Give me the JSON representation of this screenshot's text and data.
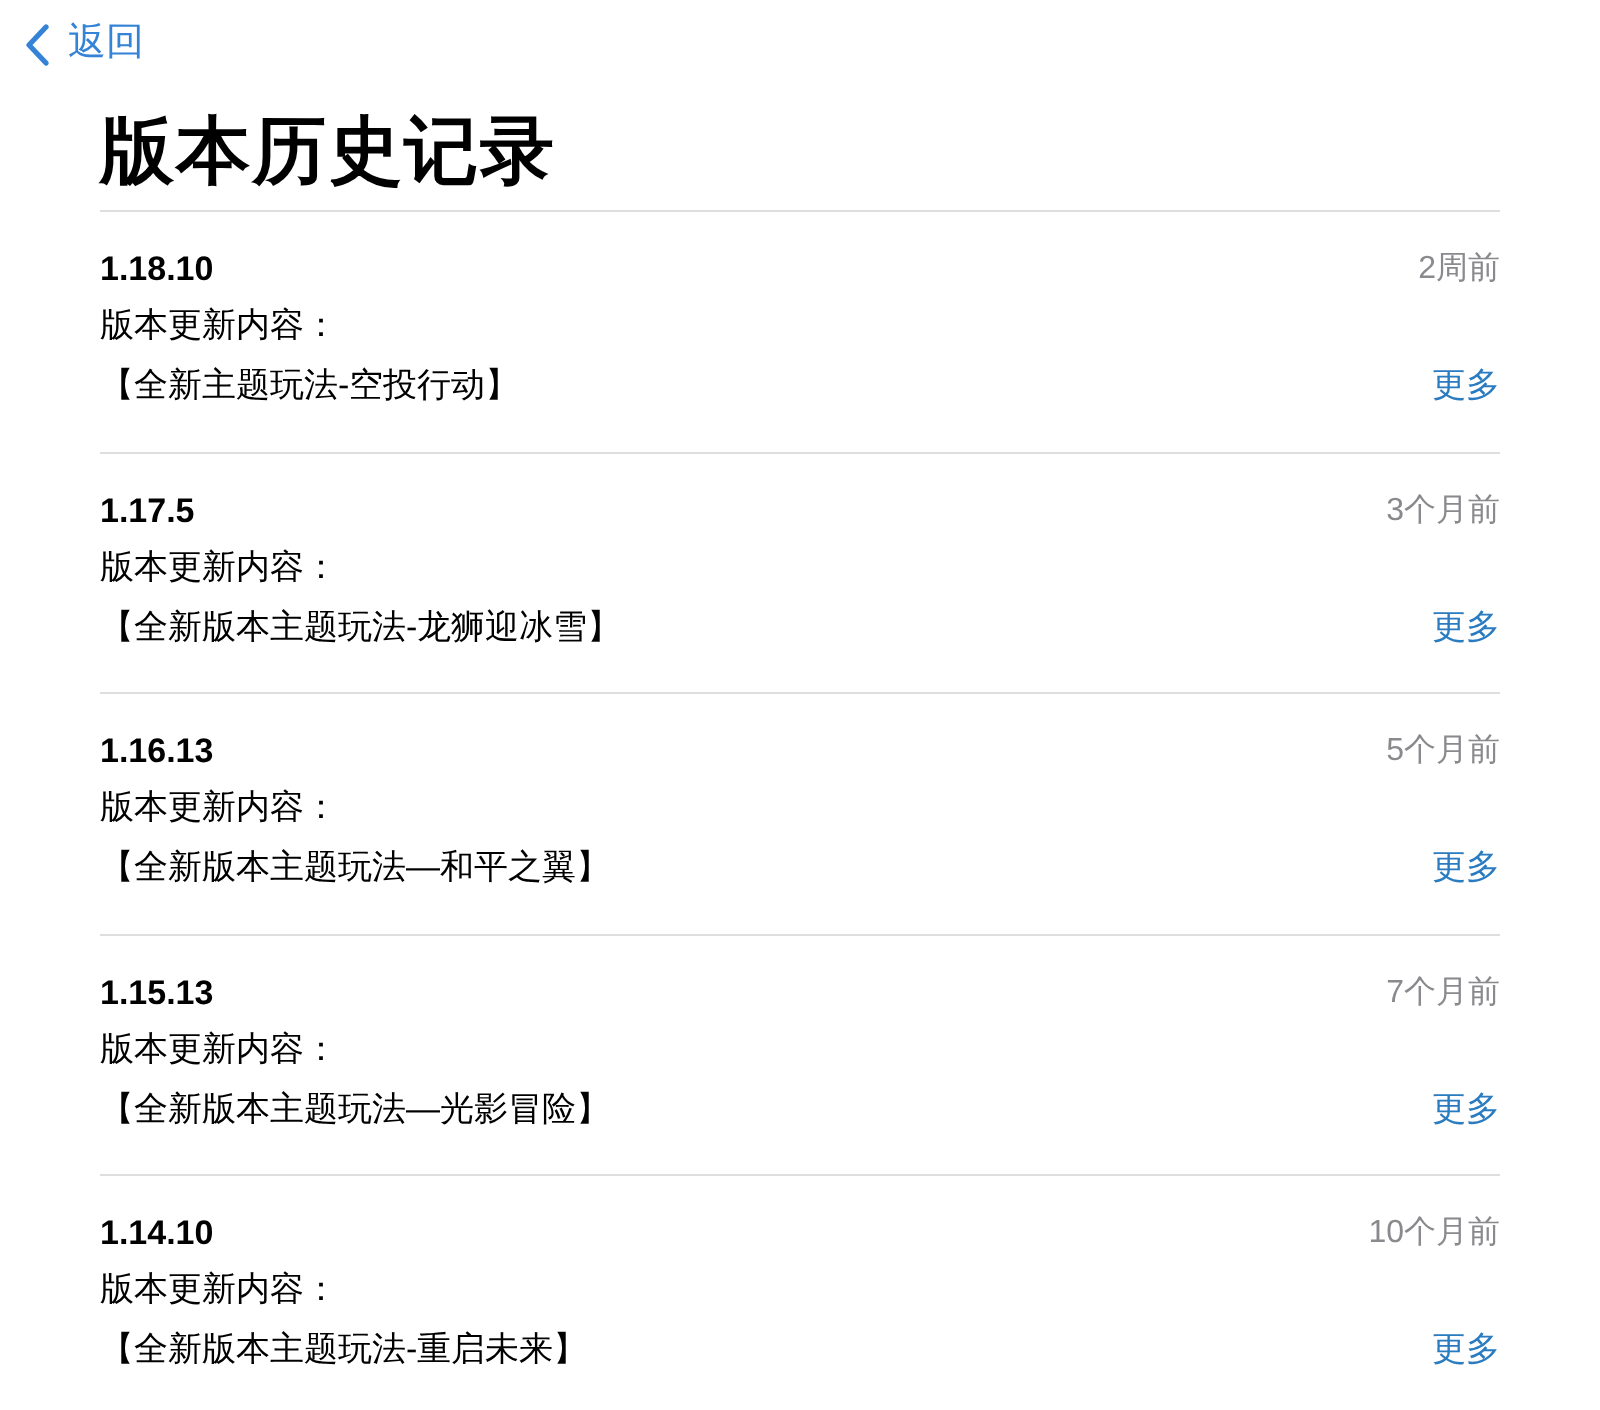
{
  "nav": {
    "back_label": "返回"
  },
  "title": "版本历史记录",
  "versions": [
    {
      "version": "1.18.10",
      "date": "2周前",
      "notes_label": "版本更新内容：",
      "notes": "【全新主题玩法-空投行动】",
      "more": "更多"
    },
    {
      "version": "1.17.5",
      "date": "3个月前",
      "notes_label": "版本更新内容：",
      "notes": "【全新版本主题玩法-龙狮迎冰雪】",
      "more": "更多"
    },
    {
      "version": "1.16.13",
      "date": "5个月前",
      "notes_label": "版本更新内容：",
      "notes": "【全新版本主题玩法—和平之翼】",
      "more": "更多"
    },
    {
      "version": "1.15.13",
      "date": "7个月前",
      "notes_label": "版本更新内容：",
      "notes": "【全新版本主题玩法—光影冒险】",
      "more": "更多"
    },
    {
      "version": "1.14.10",
      "date": "10个月前",
      "notes_label": "版本更新内容：",
      "notes": "【全新版本主题玩法-重启未来】",
      "more": "更多"
    }
  ]
}
